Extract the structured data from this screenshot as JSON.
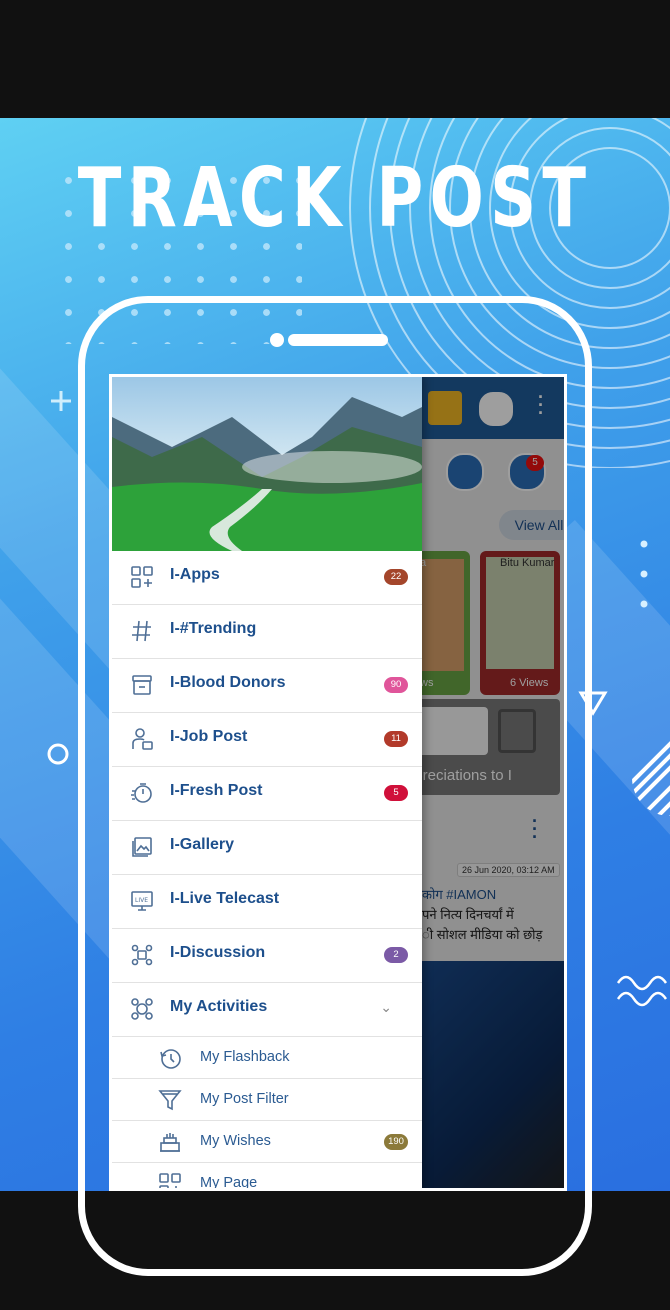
{
  "banner": {
    "title": "TRACK POST",
    "colors": {
      "gradient_start": "#5fd0f3",
      "gradient_end": "#2a6fe0"
    }
  },
  "background_app": {
    "view_all": "View All",
    "card1_name": "a",
    "card1_views": "ws",
    "card2_name": "Bitu Kumar",
    "card2_views": "6 Views",
    "notif_count": "5",
    "appreciation_text": "ppreciations to I",
    "post_date": "26 Jun 2020, 03:12 AM",
    "post_line1": "कोग #IAMON",
    "post_line2": "पने नित्य दिनचर्यां में",
    "post_line3": "ी सोशल मीडिया को छोड़"
  },
  "drawer": {
    "items": [
      {
        "label": "I-Apps",
        "icon": "apps-grid-icon",
        "badge": "22",
        "badge_color": "#a4462b"
      },
      {
        "label": "I-#Trending",
        "icon": "hashtag-icon",
        "badge": "",
        "badge_color": ""
      },
      {
        "label": "I-Blood Donors",
        "icon": "blood-donor-icon",
        "badge": "90",
        "badge_color": "#e0559a"
      },
      {
        "label": "I-Job Post",
        "icon": "job-person-icon",
        "badge": "11",
        "badge_color": "#b23a2a"
      },
      {
        "label": "I-Fresh Post",
        "icon": "stopwatch-icon",
        "badge": "5",
        "badge_color": "#d0103a"
      },
      {
        "label": "I-Gallery",
        "icon": "gallery-icon",
        "badge": "",
        "badge_color": ""
      },
      {
        "label": "I-Live Telecast",
        "icon": "live-tv-icon",
        "badge": "",
        "badge_color": ""
      },
      {
        "label": "I-Discussion",
        "icon": "discussion-icon",
        "badge": "2",
        "badge_color": "#7b5aa6"
      },
      {
        "label": "My Activities",
        "icon": "activities-icon",
        "badge": "",
        "badge_color": ""
      }
    ],
    "sub_items": [
      {
        "label": "My Flashback",
        "icon": "history-clock-icon",
        "badge": ""
      },
      {
        "label": "My Post Filter",
        "icon": "filter-funnel-icon",
        "badge": ""
      },
      {
        "label": "My Wishes",
        "icon": "birthday-cake-icon",
        "badge": "190",
        "badge_color": "#8c7a3a"
      },
      {
        "label": "My Page",
        "icon": "page-grid-icon",
        "badge": ""
      }
    ]
  }
}
